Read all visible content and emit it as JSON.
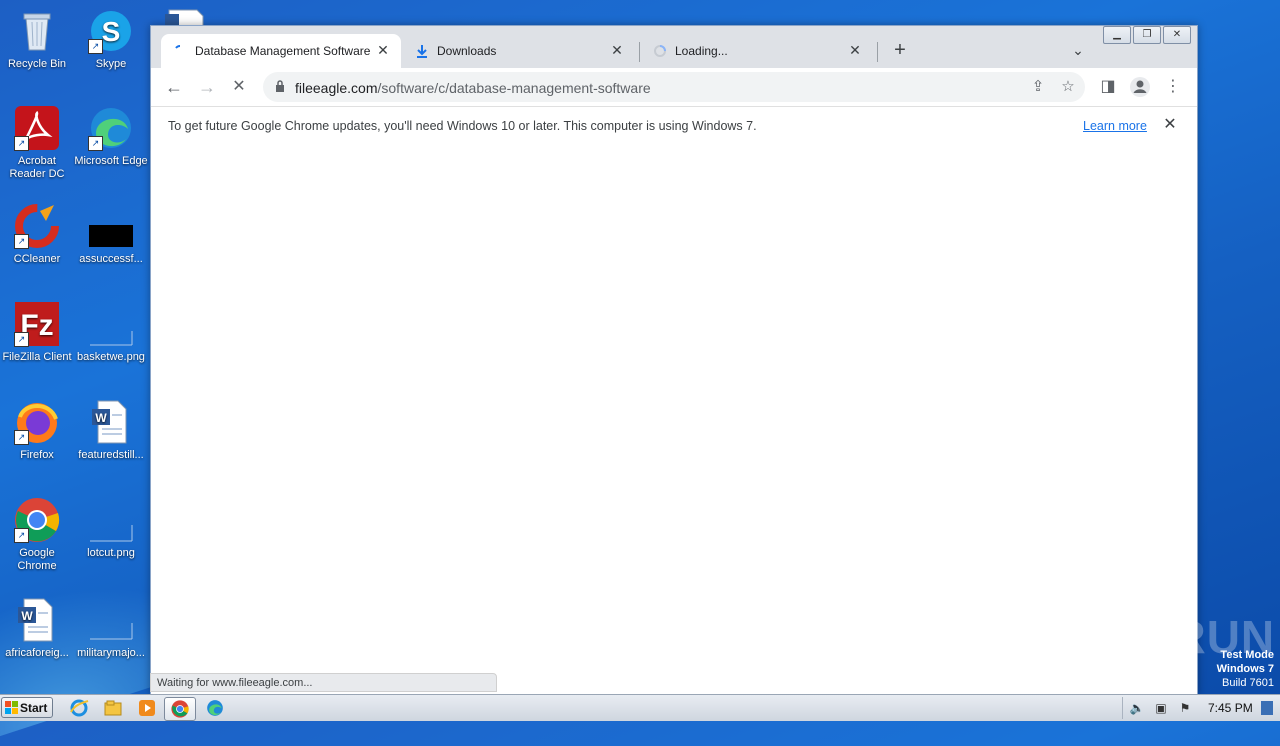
{
  "desktop": {
    "icons": [
      {
        "label": "Recycle Bin"
      },
      {
        "label": "Skype"
      },
      {
        "label": "Acrobat Reader DC"
      },
      {
        "label": "Microsoft Edge"
      },
      {
        "label": "CCleaner"
      },
      {
        "label": "assuccessf..."
      },
      {
        "label": "FileZilla Client"
      },
      {
        "label": "basketwe.png"
      },
      {
        "label": "Firefox"
      },
      {
        "label": "featuredstill..."
      },
      {
        "label": "Google Chrome"
      },
      {
        "label": "lotcut.png"
      },
      {
        "label": "africaforeig..."
      },
      {
        "label": "militarymajo..."
      }
    ]
  },
  "browser": {
    "tabs": [
      {
        "title": "Database Management Software",
        "active": true
      },
      {
        "title": "Downloads",
        "active": false
      },
      {
        "title": "Loading...",
        "active": false
      }
    ],
    "omnibox": {
      "host": "fileeagle.com",
      "path": "/software/c/database-management-software"
    },
    "infobar": {
      "message": "To get future Google Chrome updates, you'll need Windows 10 or later. This computer is using Windows 7.",
      "link": "Learn more"
    },
    "status": "Waiting for www.fileeagle.com..."
  },
  "watermark": {
    "brand": "ANY▷RUN",
    "line1": "Test Mode",
    "line2": "Windows 7",
    "line3": "Build 7601"
  },
  "taskbar": {
    "start_label": "Start",
    "clock": "7:45 PM"
  },
  "colors": {
    "accent_link": "#1a73e8",
    "desktop_blue": "#1a73d8"
  }
}
